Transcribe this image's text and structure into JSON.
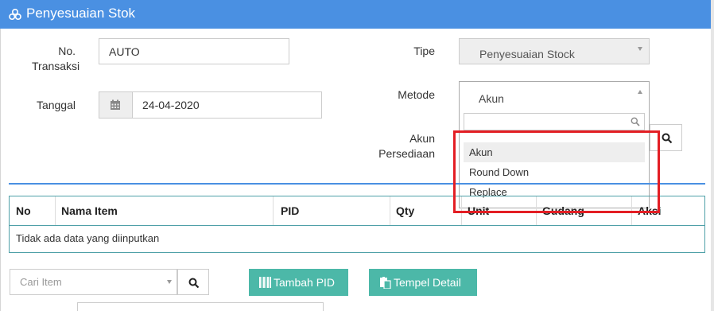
{
  "header": {
    "title": "Penyesuaian Stok",
    "icon": "cubes-icon",
    "color": "#4a90e2"
  },
  "form": {
    "no_transaksi": {
      "label_line1": "No.",
      "label_line2": "Transaksi",
      "value": "AUTO"
    },
    "tanggal": {
      "label": "Tanggal",
      "value": "24-04-2020",
      "icon": "calendar-icon"
    },
    "tipe": {
      "label": "Tipe",
      "value": "Penyesuaian Stock"
    },
    "metode": {
      "label": "Metode",
      "value": "Akun",
      "options": [
        "Akun",
        "Round Down",
        "Replace"
      ],
      "highlighted": "Akun"
    },
    "akun_persediaan": {
      "label_line1": "Akun",
      "label_line2": "Persediaan"
    }
  },
  "table": {
    "columns": [
      "No",
      "Nama Item",
      "PID",
      "Qty",
      "Unit",
      "Gudang",
      "Aksi"
    ],
    "empty_text": "Tidak ada data yang diinputkan",
    "border_color": "#4fa0a8"
  },
  "footer": {
    "cari_item_placeholder": "Cari Item",
    "tambah_pid_label": "Tambah PID",
    "tempel_detail_label": "Tempel Detail",
    "button_color": "#4cb8a8"
  },
  "annotation": {
    "highlight_color": "#e31e24"
  }
}
